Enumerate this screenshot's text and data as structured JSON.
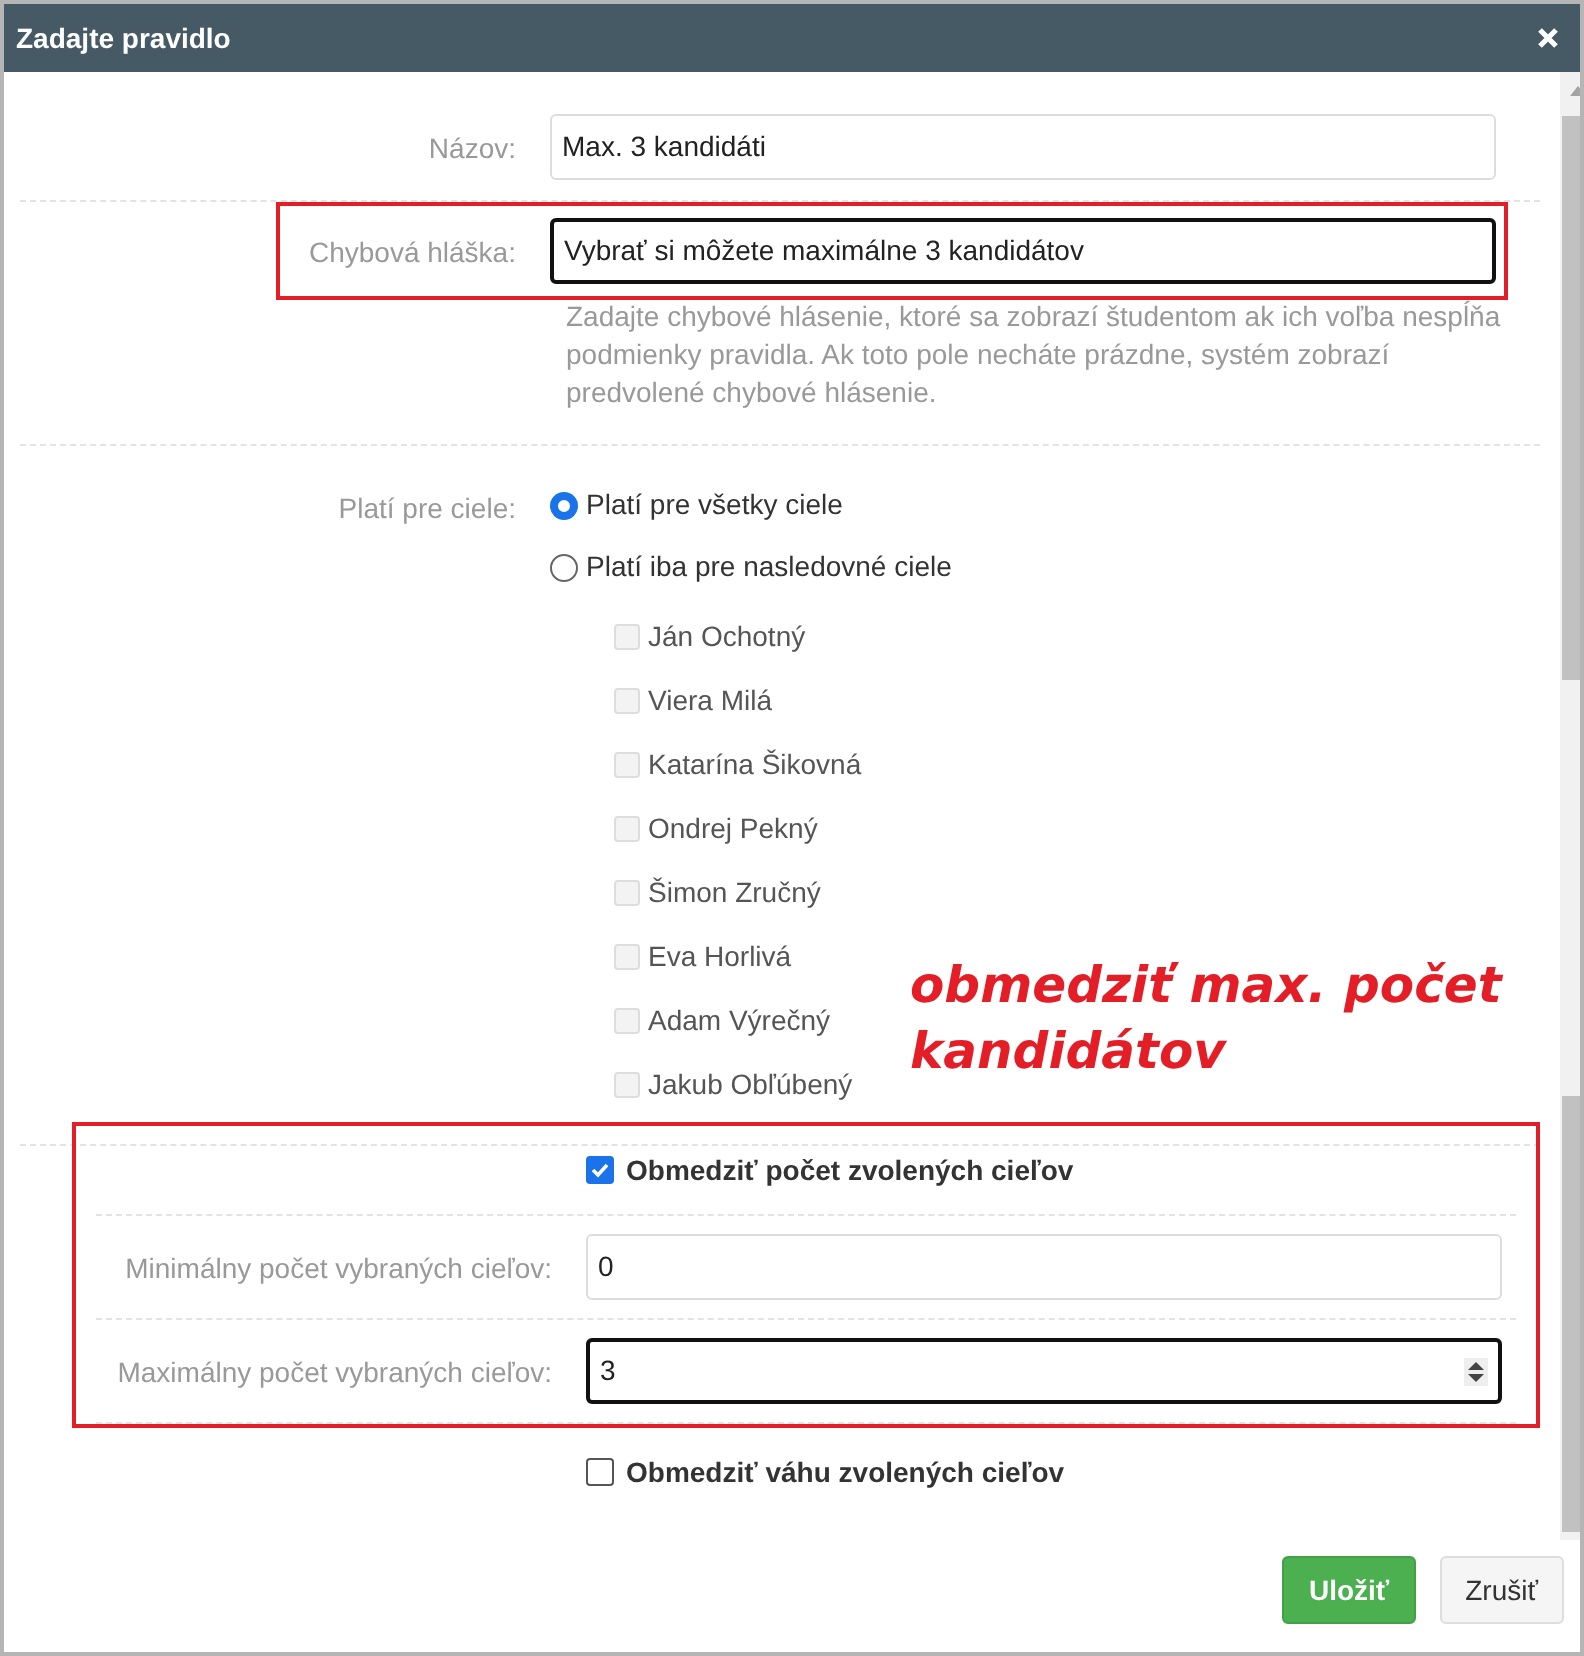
{
  "window": {
    "title": "Zadajte pravidlo"
  },
  "fields": [
    {
      "label": "Názov:",
      "value": "Max. 3 kandidáti",
      "focused": false,
      "highlighted": false
    },
    {
      "label": "Chybová hláška:",
      "value": "Vybrať si môžete maximálne 3 kandidátov",
      "focused": true,
      "highlighted": true,
      "help": "Zadajte chybové hlásenie, ktoré sa zobrazí študentom ak ich voľba nespĺňa podmienky pravidla. Ak toto pole necháte prázdne, systém zobrazí predvolené chybové hlásenie."
    }
  ],
  "targets": {
    "label": "Platí pre ciele:",
    "options": [
      {
        "label": "Platí pre všetky ciele",
        "selected": true
      },
      {
        "label": "Platí iba pre nasledovné ciele",
        "selected": false
      }
    ],
    "candidates": [
      {
        "name": "Ján Ochotný",
        "checked": false,
        "disabled": true
      },
      {
        "name": "Viera Milá",
        "checked": false,
        "disabled": true
      },
      {
        "name": "Katarína Šikovná",
        "checked": false,
        "disabled": true
      },
      {
        "name": "Ondrej Pekný",
        "checked": false,
        "disabled": true
      },
      {
        "name": "Šimon Zručný",
        "checked": false,
        "disabled": true
      },
      {
        "name": "Eva Horlivá",
        "checked": false,
        "disabled": true
      },
      {
        "name": "Adam Výrečný",
        "checked": false,
        "disabled": true
      },
      {
        "name": "Jakub Obľúbený",
        "checked": false,
        "disabled": true
      }
    ]
  },
  "limit_count": {
    "label": "Obmedziť počet zvolených cieľov",
    "checked": true,
    "highlighted": true,
    "inputs": [
      {
        "label": "Minimálny počet vybraných cieľov:",
        "value": "0",
        "focused": false
      },
      {
        "label": "Maximálny počet vybraných cieľov:",
        "value": "3",
        "focused": true
      }
    ]
  },
  "limit_weight": {
    "label": "Obmedziť váhu zvolených cieľov",
    "checked": false
  },
  "buttons": [
    {
      "label": "Uložiť",
      "kind": "primary"
    },
    {
      "label": "Zrušiť",
      "kind": "default"
    }
  ],
  "annotation": {
    "lines": [
      "obmedziť max. počet",
      "kandidátov"
    ]
  }
}
